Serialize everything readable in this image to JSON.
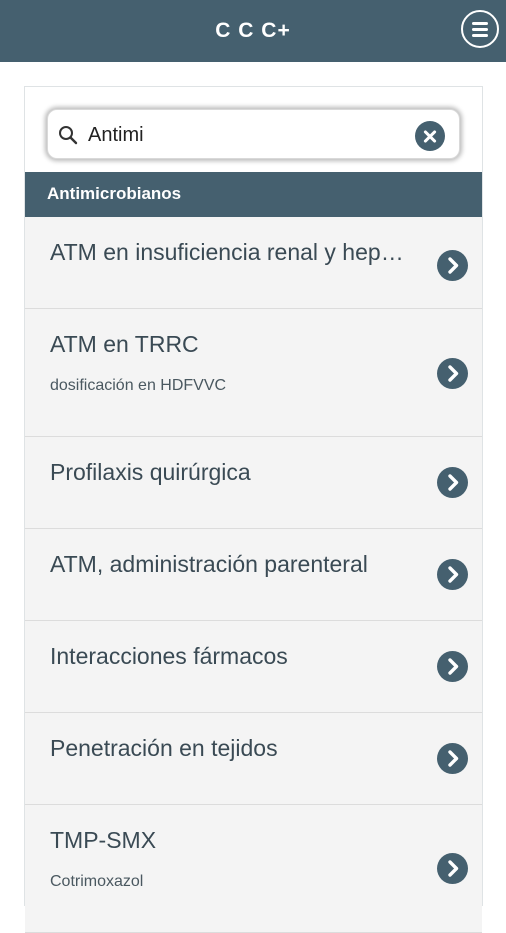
{
  "app": {
    "title": "C C C+"
  },
  "search": {
    "value": "Antimi",
    "placeholder": ""
  },
  "section": {
    "title": "Antimicrobianos"
  },
  "items": [
    {
      "title": "ATM en insuficiencia renal y hepática",
      "subtitle": ""
    },
    {
      "title": "ATM en TRRC",
      "subtitle": "dosificación en HDFVVC"
    },
    {
      "title": "Profilaxis quirúrgica",
      "subtitle": ""
    },
    {
      "title": "ATM, administración parenteral",
      "subtitle": ""
    },
    {
      "title": "Interacciones fármacos",
      "subtitle": ""
    },
    {
      "title": "Penetración en tejidos",
      "subtitle": ""
    },
    {
      "title": "TMP-SMX",
      "subtitle": "Cotrimoxazol"
    }
  ],
  "colors": {
    "primary": "#45606f",
    "row_background": "#f4f4f4",
    "text": "#3a4a54"
  },
  "icons": {
    "menu": "hamburger-icon",
    "search": "search-icon",
    "clear": "clear-icon",
    "row_arrow": "chevron-right-icon"
  }
}
